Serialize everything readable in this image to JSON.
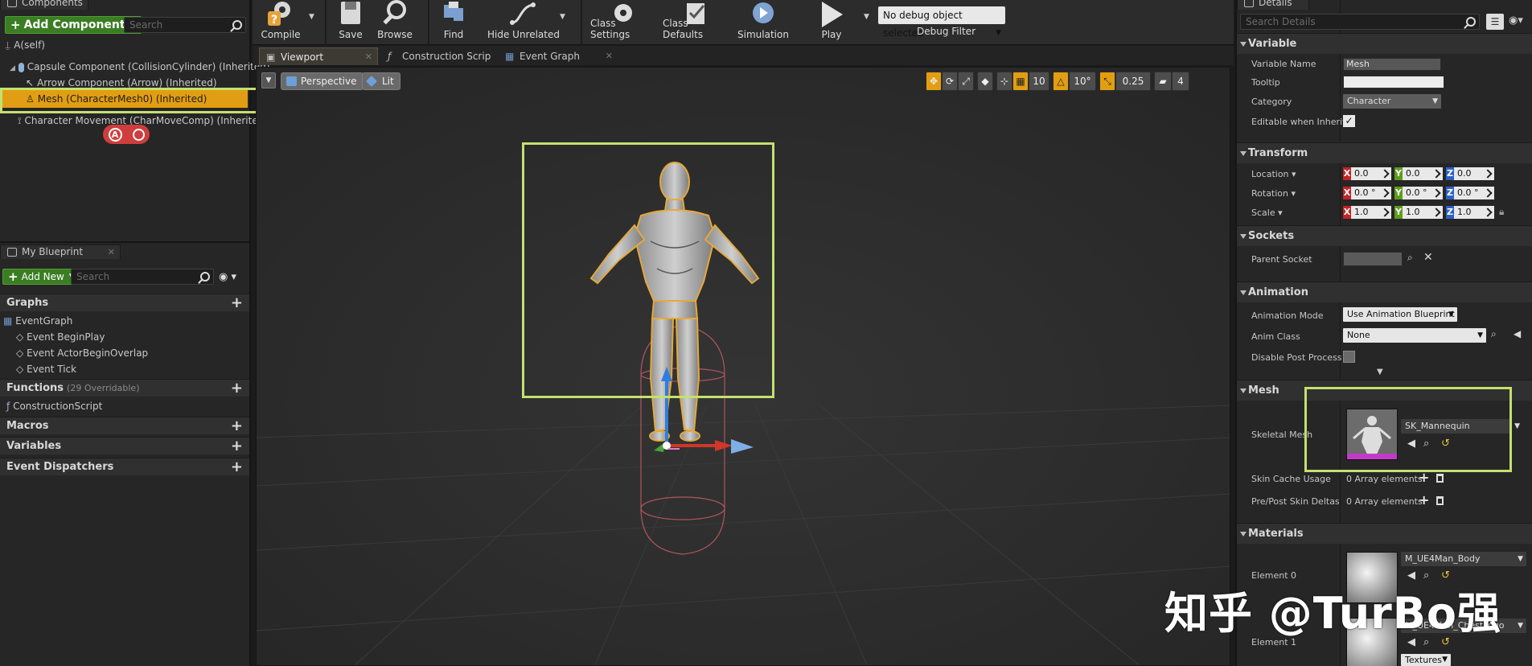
{
  "components_panel": {
    "tab_label": "Components",
    "add_component_label": "Add Component",
    "search_placeholder": "Search",
    "items": [
      {
        "label": "A(self)"
      },
      {
        "label": "Capsule Component (CollisionCylinder) (Inherited)"
      },
      {
        "label": "Arrow Component (Arrow) (Inherited)"
      },
      {
        "label": "Mesh (CharacterMesh0) (Inherited)",
        "selected": true
      },
      {
        "label": "Character Movement (CharMoveComp) (Inherited)"
      }
    ],
    "mini_buttons": [
      "A",
      "search-icon"
    ]
  },
  "my_blueprint": {
    "tab_label": "My Blueprint",
    "add_new_label": "Add New",
    "search_placeholder": "Search",
    "sections": {
      "graphs": "Graphs",
      "functions": "Functions",
      "functions_sub": "(29 Overridable)",
      "macros": "Macros",
      "variables": "Variables",
      "dispatchers": "Event Dispatchers"
    },
    "graph_items": [
      "EventGraph",
      "Event BeginPlay",
      "Event ActorBeginOverlap",
      "Event Tick"
    ],
    "function_items": [
      "ConstructionScript"
    ]
  },
  "toolbar": {
    "buttons": [
      "Compile",
      "Save",
      "Browse",
      "Find",
      "Hide Unrelated",
      "Class Settings",
      "Class Defaults",
      "Simulation",
      "Play"
    ],
    "debug_select": "No debug object selected",
    "debug_label": "Debug Filter"
  },
  "tabs": [
    "Viewport",
    "Construction Scrip",
    "Event Graph"
  ],
  "viewport": {
    "perspective": "Perspective",
    "lit": "Lit",
    "grid_snap": "10",
    "rot_snap": "10°",
    "scale_snap": "0.25",
    "cam_speed": "4"
  },
  "details": {
    "tab_label": "Details",
    "search_placeholder": "Search Details",
    "variable": {
      "header": "Variable",
      "name_label": "Variable Name",
      "name_value": "Mesh",
      "tooltip_label": "Tooltip",
      "tooltip_value": "",
      "category_label": "Category",
      "category_value": "Character",
      "editable_label": "Editable when Inherite"
    },
    "transform": {
      "header": "Transform",
      "location_label": "Location",
      "rotation_label": "Rotation",
      "scale_label": "Scale",
      "location": [
        "0.0",
        "0.0",
        "0.0"
      ],
      "rotation": [
        "0.0 °",
        "0.0 °",
        "0.0 °"
      ],
      "scale": [
        "1.0",
        "1.0",
        "1.0"
      ]
    },
    "sockets": {
      "header": "Sockets",
      "parent_label": "Parent Socket"
    },
    "animation": {
      "header": "Animation",
      "mode_label": "Animation Mode",
      "mode_value": "Use Animation Blueprint",
      "class_label": "Anim Class",
      "class_value": "None",
      "dpp_label": "Disable Post Process"
    },
    "mesh": {
      "header": "Mesh",
      "skeletal_label": "Skeletal Mesh",
      "skeletal_value": "SK_Mannequin",
      "skin_cache_label": "Skin Cache Usage",
      "skin_cache_value": "0 Array elements",
      "pre_post_label": "Pre/Post Skin Deltas",
      "pre_post_value": "0 Array elements"
    },
    "materials": {
      "header": "Materials",
      "el0_label": "Element 0",
      "el0_value": "M_UE4Man_Body",
      "el1_label": "Element 1",
      "el1_value": "M_UE4Man_ChestLogo",
      "textures_label": "Textures"
    }
  },
  "watermark": "知乎 @TurBo强",
  "colors": {
    "selection": "#e29e12",
    "highlight": "#c4e070",
    "add_green": "#3a7d23"
  }
}
